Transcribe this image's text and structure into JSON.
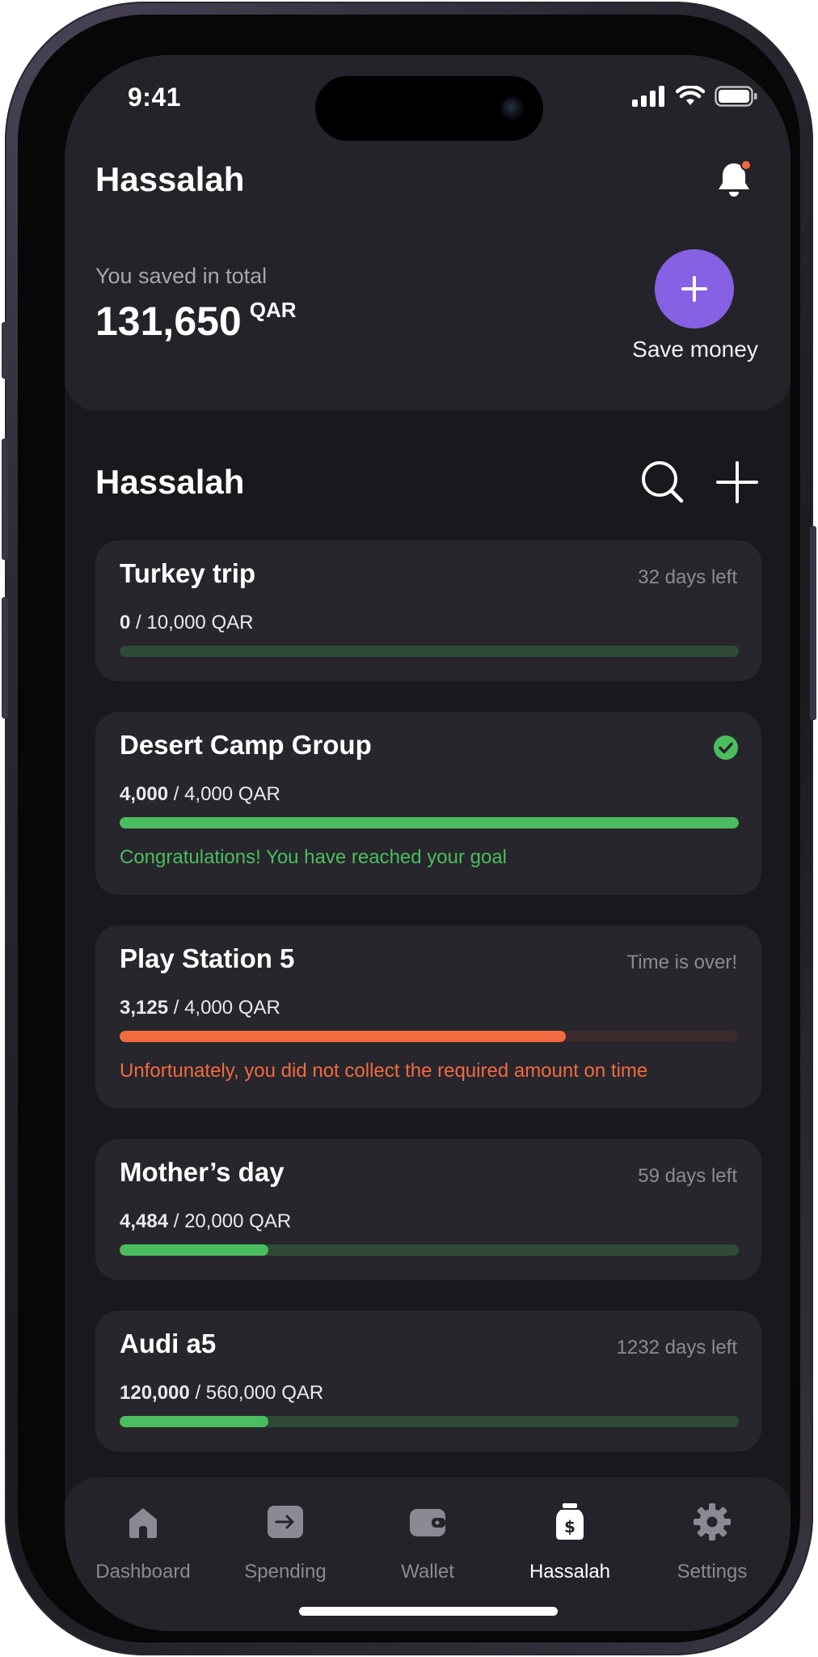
{
  "status_bar": {
    "time": "9:41"
  },
  "header": {
    "title": "Hassalah",
    "saved_label": "You saved in total",
    "saved_amount": "131,650",
    "saved_unit": "QAR",
    "save_button_label": "Save money"
  },
  "section": {
    "title": "Hassalah"
  },
  "goals": [
    {
      "title": "Turkey trip",
      "meta": "32 days left",
      "saved": "0",
      "target": "/ 10,000 QAR",
      "progress": 0,
      "status": "active",
      "message": ""
    },
    {
      "title": "Desert Camp Group",
      "meta": "",
      "saved": "4,000",
      "target": "/ 4,000 QAR",
      "progress": 1.0,
      "status": "completed",
      "message": "Congratulations! You have reached your goal"
    },
    {
      "title": "Play Station 5",
      "meta": "Time is over!",
      "saved": "3,125",
      "target": "/ 4,000 QAR",
      "progress": 0.72,
      "status": "expired",
      "message": "Unfortunately, you did not collect the required amount on time"
    },
    {
      "title": "Mother’s day",
      "meta": "59 days left",
      "saved": "4,484",
      "target": "/ 20,000 QAR",
      "progress": 0.24,
      "status": "active",
      "message": ""
    },
    {
      "title": "Audi a5",
      "meta": "1232 days left",
      "saved": "120,000",
      "target": "/ 560,000 QAR",
      "progress": 0.24,
      "status": "active",
      "message": ""
    }
  ],
  "tabbar": {
    "tabs": [
      {
        "label": "Dashboard",
        "icon": "home-icon",
        "active": false
      },
      {
        "label": "Spending",
        "icon": "transfer-icon",
        "active": false
      },
      {
        "label": "Wallet",
        "icon": "wallet-icon",
        "active": false
      },
      {
        "label": "Hassalah",
        "icon": "money-jar-icon",
        "active": true
      },
      {
        "label": "Settings",
        "icon": "gear-icon",
        "active": false
      }
    ]
  },
  "colors": {
    "accent": "#8661e4",
    "success": "#4cbd5e",
    "success_track": "#2f4a37",
    "danger": "#f26a3f",
    "danger_track": "#3a2a2b",
    "notification_dot": "#f26a3f"
  }
}
